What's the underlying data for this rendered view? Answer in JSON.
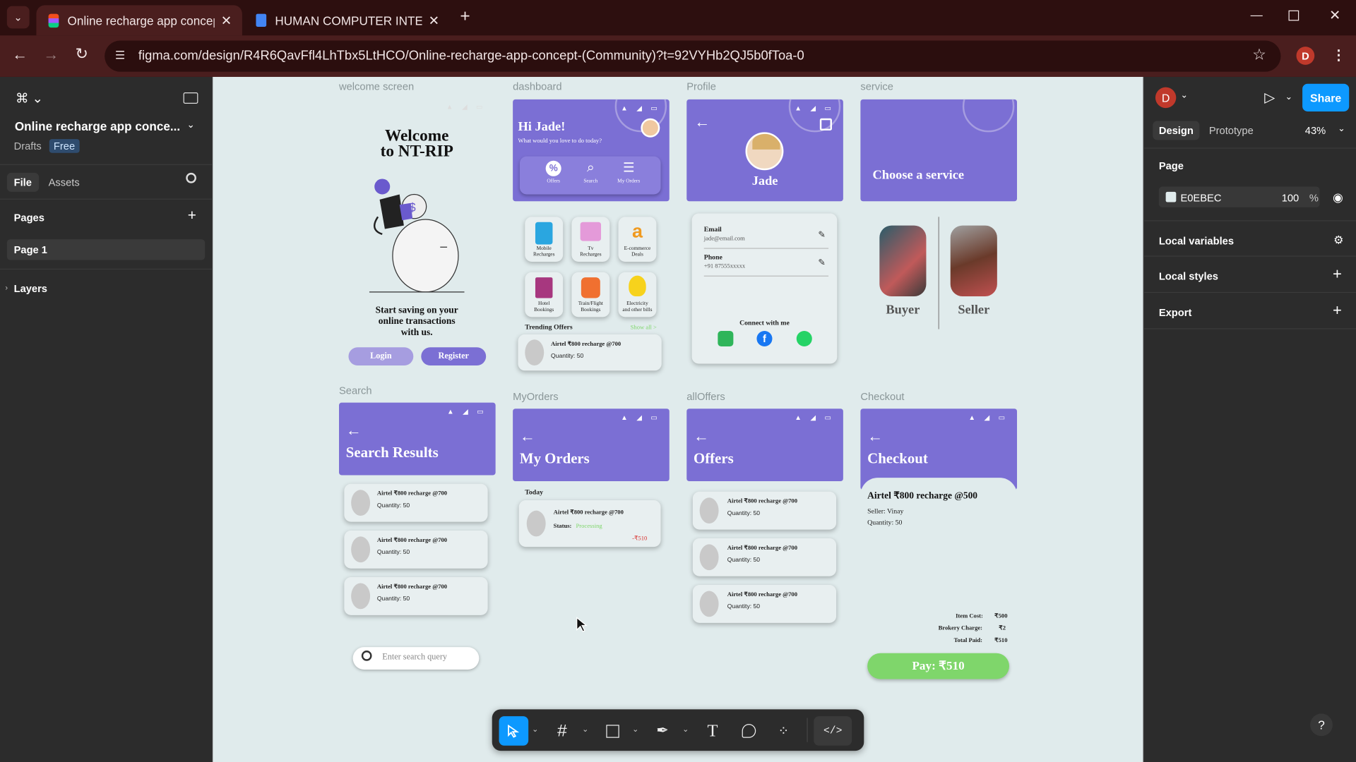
{
  "browser": {
    "tabs": [
      {
        "title": "Online recharge app concept (C"
      },
      {
        "title": "HUMAN COMPUTER INTERACTI"
      }
    ],
    "url": "figma.com/design/R4R6QavFfl4LhTbx5LtHCO/Online-recharge-app-concept-(Community)?t=92VYHb2QJ5b0fToa-0",
    "profile_initial": "D"
  },
  "left_panel": {
    "file_name": "Online recharge app conce...",
    "drafts": "Drafts",
    "plan": "Free",
    "tabs": [
      "File",
      "Assets"
    ],
    "pages_label": "Pages",
    "page_item": "Page 1",
    "layers_label": "Layers"
  },
  "right_panel": {
    "avatar": "D",
    "share": "Share",
    "tabs": [
      "Design",
      "Prototype"
    ],
    "zoom": "43%",
    "page_label": "Page",
    "page_color": "E0EBEC",
    "opacity": "100",
    "percent": "%",
    "sections": [
      "Local variables",
      "Local styles",
      "Export"
    ]
  },
  "canvas": {
    "frame_labels": {
      "welcome": "welcome screen",
      "dashboard": "dashboard",
      "profile": "Profile",
      "service": "service",
      "search": "Search",
      "myorders": "MyOrders",
      "alloffers": "allOffers",
      "checkout": "Checkout"
    },
    "welcome": {
      "title1": "Welcome",
      "title2": "to NT-RIP",
      "text1": "Start saving on your",
      "text2": "online transactions",
      "text3": "with us.",
      "login": "Login",
      "register": "Register"
    },
    "dashboard": {
      "greeting": "Hi Jade!",
      "subtitle": "What would you love to do today?",
      "nav": [
        "Offers",
        "Search",
        "My Orders"
      ],
      "tiles": [
        {
          "l1": "Mobile",
          "l2": "Recharges"
        },
        {
          "l1": "Tv",
          "l2": "Recharges"
        },
        {
          "l1": "E-commerce",
          "l2": "Deals"
        },
        {
          "l1": "Hotel",
          "l2": "Bookings"
        },
        {
          "l1": "Train/Flight",
          "l2": "Bookings"
        },
        {
          "l1": "Electricity",
          "l2": "and other bills"
        }
      ],
      "trending": "Trending Offers",
      "showall": "Show all >",
      "offer_title": "Airtel ₹800 recharge @700",
      "offer_qty": "Quantity: 50"
    },
    "profile": {
      "name": "Jade",
      "email_label": "Email",
      "email": "jade@email.com",
      "phone_label": "Phone",
      "phone": "+91 87555xxxxx",
      "connect": "Connect with me"
    },
    "service": {
      "title": "Choose a service",
      "buyer": "Buyer",
      "seller": "Seller"
    },
    "search": {
      "title": "Search Results",
      "item_title": "Airtel ₹800 recharge @700",
      "item_qty": "Quantity: 50",
      "placeholder": "Enter search query"
    },
    "myorders": {
      "title": "My Orders",
      "today": "Today",
      "item_title": "Airtel ₹800 recharge @700",
      "status_label": "Status:",
      "status_value": "Processing",
      "amount": "-₹510"
    },
    "offers": {
      "title": "Offers",
      "item_title": "Airtel ₹800 recharge @700",
      "item_qty": "Quantity: 50"
    },
    "checkout": {
      "title": "Checkout",
      "item": "Airtel ₹800 recharge @500",
      "seller": "Seller: Vinay",
      "qty": "Quantity: 50",
      "item_cost_label": "Item Cost:",
      "item_cost": "₹500",
      "brokery_label": "Brokery Charge:",
      "brokery": "₹2",
      "total_label": "Total Paid:",
      "total": "₹510",
      "pay": "Pay: ₹510"
    }
  },
  "help": "?",
  "colors": {
    "primary": "#7b6fd4",
    "accent_green": "#7fd66b",
    "figma_blue": "#0d99ff"
  }
}
